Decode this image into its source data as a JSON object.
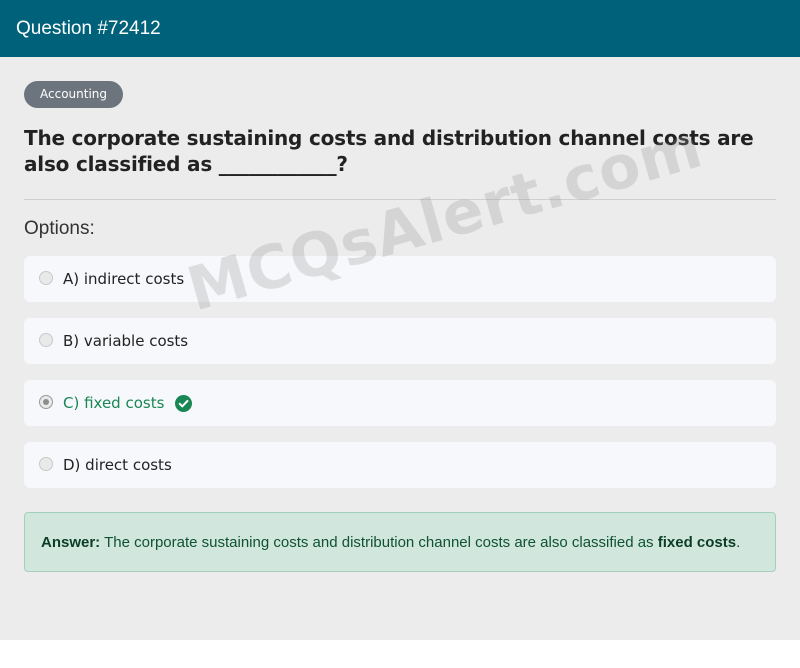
{
  "header": {
    "title": "Question #72412"
  },
  "category": {
    "label": "Accounting"
  },
  "question": {
    "text": "The corporate sustaining costs and distribution channel costs are also classified as ____________?"
  },
  "options_section": {
    "label": "Options:"
  },
  "options": [
    {
      "text": "A) indirect costs",
      "selected": false,
      "correct": false
    },
    {
      "text": "B) variable costs",
      "selected": false,
      "correct": false
    },
    {
      "text": "C) fixed costs",
      "selected": true,
      "correct": true
    },
    {
      "text": "D) direct costs",
      "selected": false,
      "correct": false
    }
  ],
  "answer": {
    "label": "Answer:",
    "sentence": "The corporate sustaining costs and distribution channel costs are also classified as",
    "value": "fixed costs",
    "end": "."
  },
  "watermark": {
    "text": "MCQsAlert.com"
  },
  "colors": {
    "header_bg": "#00627a",
    "badge_bg": "#6c757d",
    "correct_green": "#198754",
    "answer_bg": "#d1e7dd"
  },
  "icons": {
    "correct_option": "check-circle-icon"
  }
}
